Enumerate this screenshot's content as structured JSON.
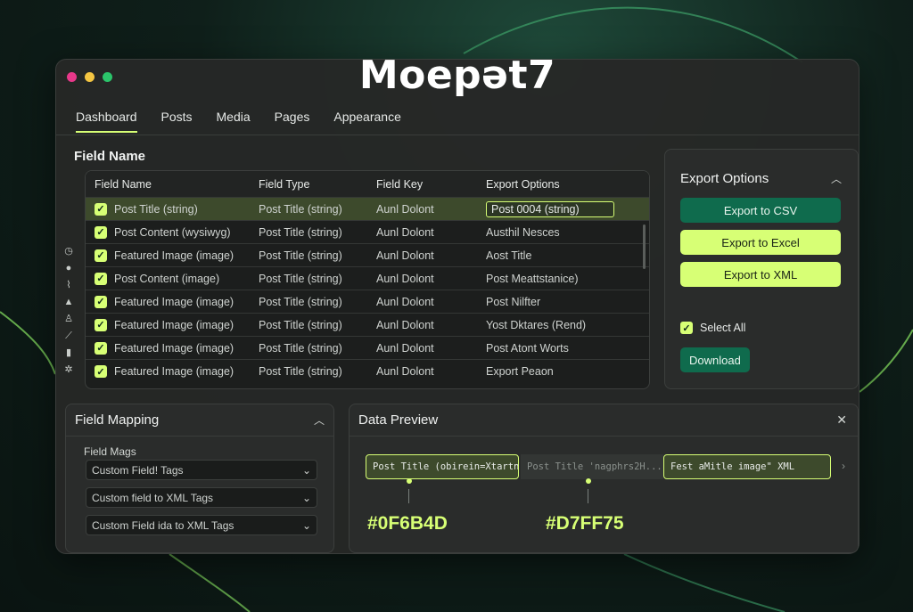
{
  "app": {
    "title": "Moepət7",
    "traffic_colors": [
      "#e8388a",
      "#f4c542",
      "#2bc46a"
    ]
  },
  "tabs": [
    {
      "label": "Dashboard",
      "active": true
    },
    {
      "label": "Posts",
      "active": false
    },
    {
      "label": "Media",
      "active": false
    },
    {
      "label": "Pages",
      "active": false
    },
    {
      "label": "Appearance",
      "active": false
    }
  ],
  "section_title": "Field Name",
  "sidebar_icons": [
    "clock-icon",
    "globe-icon",
    "tools-icon",
    "user-icon",
    "users-icon",
    "pin-icon",
    "clipboard-icon",
    "gear-icon"
  ],
  "table": {
    "headers": [
      "Field Name",
      "Field Type",
      "Field Key",
      "Export Options"
    ],
    "rows": [
      {
        "name": "Post Title (string)",
        "type": "Post Title (string)",
        "key": "Aunl Dolont",
        "export": "Post 0004 (string)",
        "selected": true
      },
      {
        "name": "Post Content (wysiwyg)",
        "type": "Post Title (string)",
        "key": "Aunl Dolont",
        "export": "Austhil Nesces",
        "selected": false
      },
      {
        "name": "Featured Image (image)",
        "type": "Post Title (string)",
        "key": "Aunl Dolont",
        "export": "Aost Title",
        "selected": false
      },
      {
        "name": "Post Content (image)",
        "type": "Post Title (string)",
        "key": "Aunl Dolont",
        "export": "Post Meattstanice)",
        "selected": false
      },
      {
        "name": "Featured Image (image)",
        "type": "Post Title (string)",
        "key": "Aunl Dolont",
        "export": "Post Nilfter",
        "selected": false
      },
      {
        "name": "Featured Image (image)",
        "type": "Post Title (string)",
        "key": "Aunl Dolont",
        "export": "Yost Dktares (Rend)",
        "selected": false
      },
      {
        "name": "Featured Image (image)",
        "type": "Post Title (string)",
        "key": "Aunl Dolont",
        "export": "Post Atont Worts",
        "selected": false
      },
      {
        "name": "Featured Image (image)",
        "type": "Post Title (string)",
        "key": "Aunl Dolont",
        "export": "Export Peaon",
        "selected": false
      }
    ]
  },
  "export_options": {
    "title": "Export Options",
    "csv_label": "Export to CSV",
    "excel_label": "Export to Excel",
    "xml_label": "Export to XML",
    "select_all_label": "Select All",
    "select_all_checked": true,
    "download_label": "Download"
  },
  "field_mapping": {
    "title": "Field Mapping",
    "subtitle": "Field Mags",
    "dropdowns": [
      "Custom Field! Tags",
      "Custom field to XML Tags",
      "Custom Field ida to XML Tags"
    ]
  },
  "data_preview": {
    "title": "Data Preview",
    "cells": [
      "Post Title (obirein=Xtartn)",
      "Post Title 'nagphrs2H...",
      "Fest aMitle image\" XML"
    ],
    "hex_labels": [
      "#0F6B4D",
      "#D7FF75"
    ]
  },
  "colors": {
    "accent": "#d7ff75",
    "primary": "#0f6b4d",
    "background": "#0f1f1a"
  }
}
